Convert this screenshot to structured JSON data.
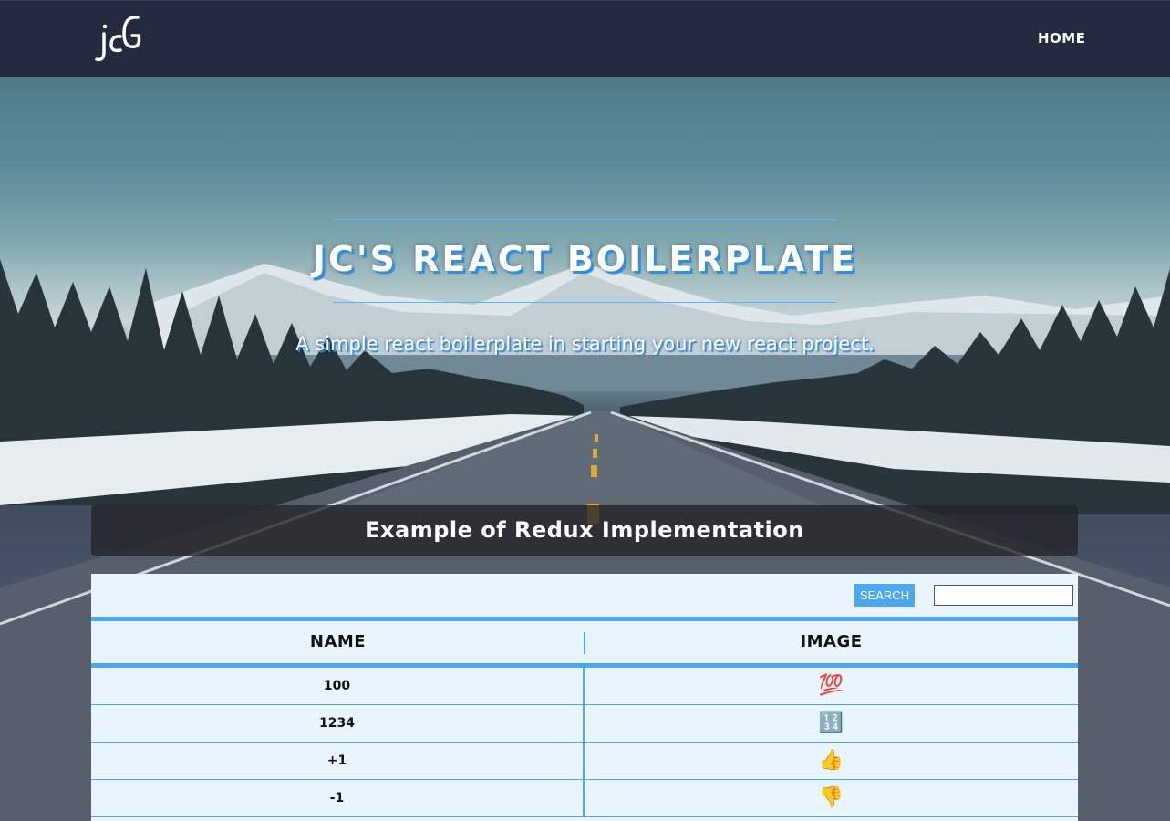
{
  "navbar": {
    "logo_text": "jcG",
    "links": [
      {
        "label": "HOME"
      }
    ]
  },
  "hero": {
    "title": "JC'S REACT BOILERPLATE",
    "subtitle": "A simple react boilerplate in starting your new react project."
  },
  "section": {
    "title": "Example of Redux Implementation"
  },
  "toolbar": {
    "search_label": "SEARCH",
    "search_value": "",
    "search_placeholder": ""
  },
  "table": {
    "columns": [
      "NAME",
      "IMAGE"
    ],
    "rows": [
      {
        "name": "100",
        "image": "💯"
      },
      {
        "name": "1234",
        "image": "🔢"
      },
      {
        "name": "+1",
        "image": "👍"
      },
      {
        "name": "-1",
        "image": "👎"
      }
    ]
  },
  "colors": {
    "navbar_bg": "#242a40",
    "accent": "#4ba8f0",
    "panel_bg": "#e9f5fe"
  }
}
